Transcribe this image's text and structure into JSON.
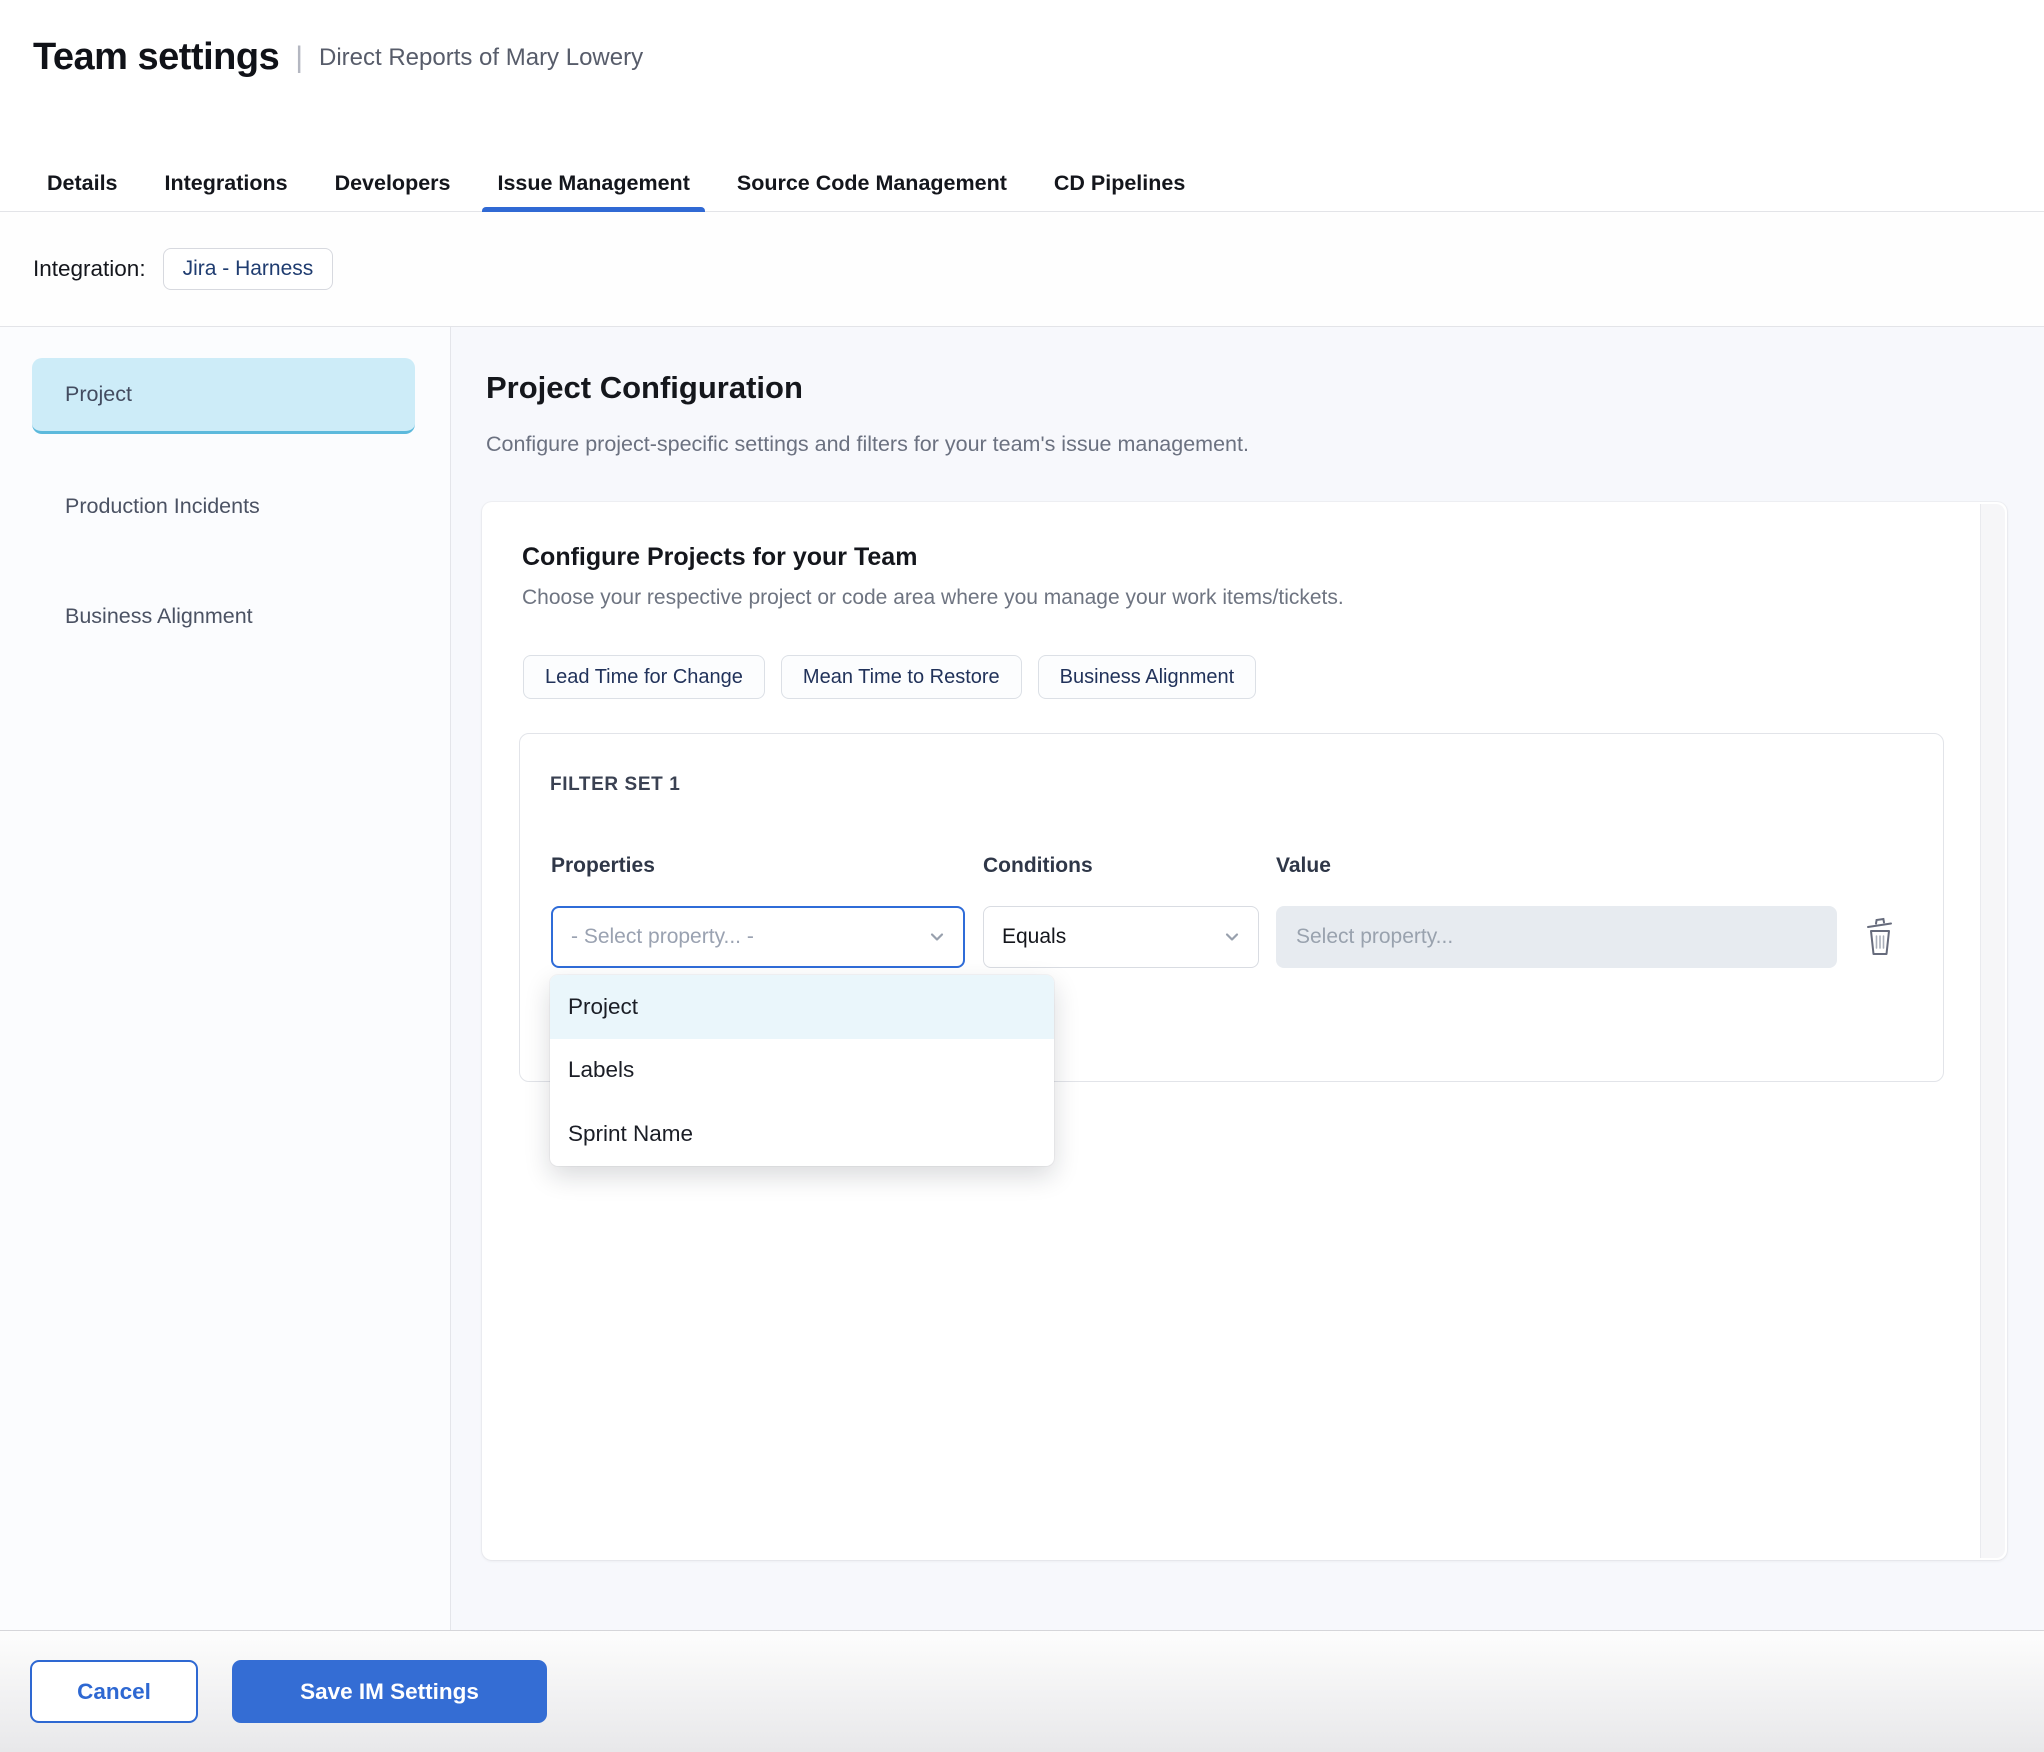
{
  "header": {
    "title": "Team settings",
    "separator": "|",
    "subtitle": "Direct Reports of Mary Lowery"
  },
  "tabs": [
    {
      "label": "Details",
      "active": false
    },
    {
      "label": "Integrations",
      "active": false
    },
    {
      "label": "Developers",
      "active": false
    },
    {
      "label": "Issue Management",
      "active": true
    },
    {
      "label": "Source Code Management",
      "active": false
    },
    {
      "label": "CD Pipelines",
      "active": false
    }
  ],
  "integration": {
    "label": "Integration:",
    "value": "Jira - Harness"
  },
  "sidebar": {
    "items": [
      {
        "label": "Project",
        "selected": true
      },
      {
        "label": "Production Incidents",
        "selected": false
      },
      {
        "label": "Business Alignment",
        "selected": false
      }
    ]
  },
  "main": {
    "heading": "Project Configuration",
    "description": "Configure project-specific settings and filters for your team's issue management.",
    "card": {
      "title": "Configure Projects for your Team",
      "description": "Choose your respective project or code area where you manage your work items/tickets.",
      "metric_chips": [
        {
          "label": "Lead Time for Change"
        },
        {
          "label": "Mean Time to Restore"
        },
        {
          "label": "Business Alignment"
        }
      ],
      "filter_set": {
        "title": "FILTER SET 1",
        "columns": {
          "properties": "Properties",
          "conditions": "Conditions",
          "value": "Value"
        },
        "property_select": {
          "placeholder": "- Select property... -"
        },
        "condition_select": {
          "value": "Equals"
        },
        "value_input": {
          "placeholder": "Select property...",
          "value": ""
        },
        "property_dropdown": {
          "options": [
            {
              "label": "Project",
              "highlighted": true
            },
            {
              "label": "Labels",
              "highlighted": false
            },
            {
              "label": "Sprint Name",
              "highlighted": false
            }
          ]
        }
      }
    }
  },
  "footer": {
    "cancel_label": "Cancel",
    "save_label": "Save IM Settings"
  },
  "colors": {
    "accent_blue": "#3069d4",
    "focus_border": "#2f6cd8",
    "tab_underline": "#3069d4",
    "sidebar_selected_bg": "#cdecf8",
    "sidebar_selected_border": "#5cb9dc",
    "dropdown_highlight": "#eaf6fb",
    "value_input_bg": "#e7ebf0",
    "chip_text": "#21325a",
    "content_bg": "#f7f8fc"
  }
}
